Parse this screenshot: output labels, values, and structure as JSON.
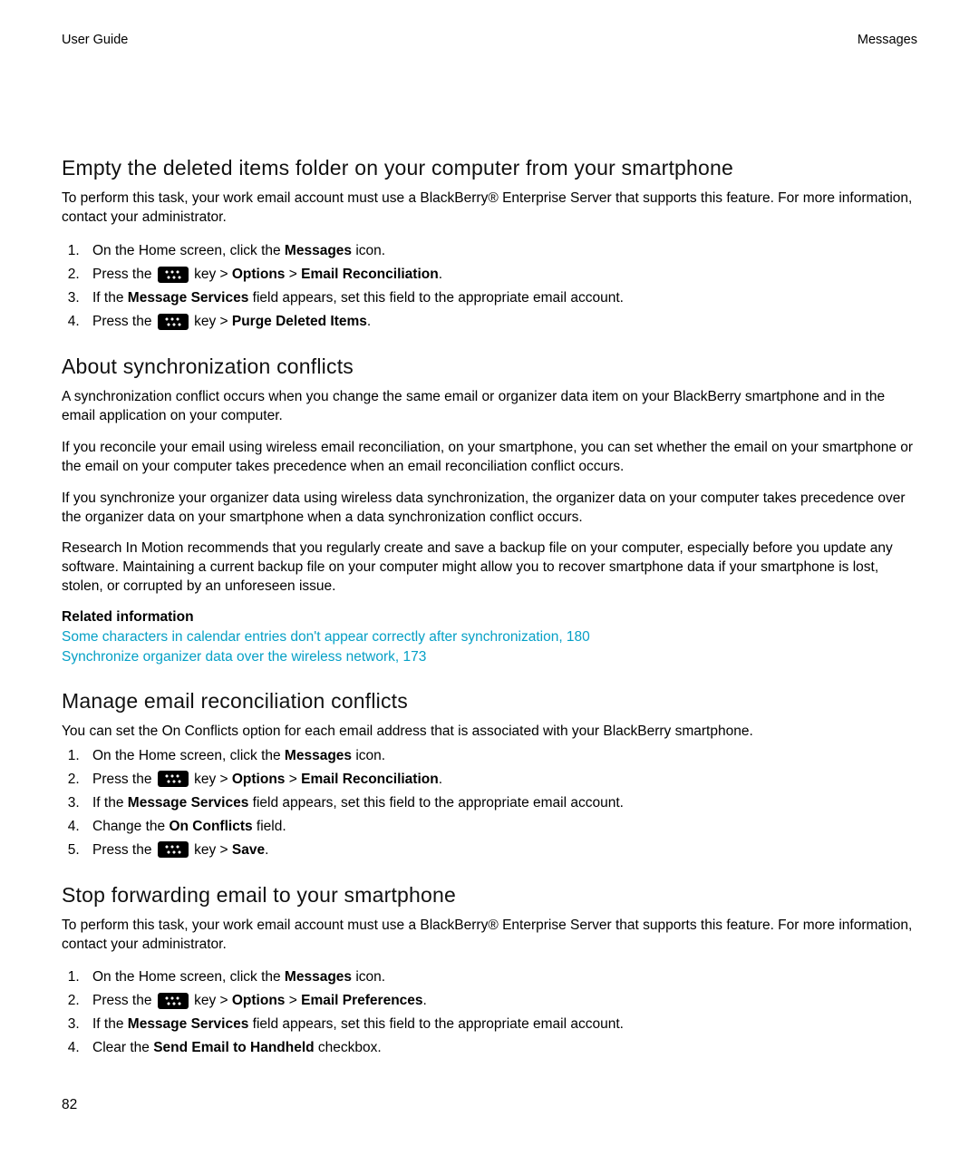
{
  "header": {
    "left": "User Guide",
    "right": "Messages"
  },
  "page_number": "82",
  "sec1": {
    "title": "Empty the deleted items folder on your computer from your smartphone",
    "intro": "To perform this task, your work email account must use a BlackBerry® Enterprise Server that supports this feature. For more information, contact your administrator.",
    "li1a": "On the Home screen, click the ",
    "li1b": "Messages",
    "li1c": " icon.",
    "li2a": "Press the ",
    "li2b": " key > ",
    "li2c": "Options",
    "li2d": " > ",
    "li2e": "Email Reconciliation",
    "li2f": ".",
    "li3a": "If the ",
    "li3b": "Message Services",
    "li3c": " field appears, set this field to the appropriate email account.",
    "li4a": "Press the ",
    "li4b": " key > ",
    "li4c": "Purge Deleted Items",
    "li4d": "."
  },
  "sec2": {
    "title": "About synchronization conflicts",
    "p1": "A synchronization conflict occurs when you change the same email or organizer data item on your BlackBerry smartphone and in the email application on your computer.",
    "p2": "If you reconcile your email using wireless email reconciliation, on your smartphone, you can set whether the email on your smartphone or the email on your computer takes precedence when an email reconciliation conflict occurs.",
    "p3": "If you synchronize your organizer data using wireless data synchronization, the organizer data on your computer takes precedence over the organizer data on your smartphone when a data synchronization conflict occurs.",
    "p4": "Research In Motion recommends that you regularly create and save a backup file on your computer, especially before you update any software. Maintaining a current backup file on your computer might allow you to recover smartphone data if your smartphone is lost, stolen, or corrupted by an unforeseen issue.",
    "related_heading": "Related information",
    "link1": "Some characters in calendar entries don't appear correctly after synchronization, 180",
    "link2": "Synchronize organizer data over the wireless network, 173"
  },
  "sec3": {
    "title": "Manage email reconciliation conflicts",
    "intro": "You can set the On Conflicts option for each email address that is associated with your BlackBerry smartphone.",
    "li1a": "On the Home screen, click the ",
    "li1b": "Messages",
    "li1c": " icon.",
    "li2a": "Press the ",
    "li2b": " key > ",
    "li2c": "Options",
    "li2d": " > ",
    "li2e": "Email Reconciliation",
    "li2f": ".",
    "li3a": "If the ",
    "li3b": "Message Services",
    "li3c": " field appears, set this field to the appropriate email account.",
    "li4a": "Change the ",
    "li4b": "On Conflicts",
    "li4c": " field.",
    "li5a": "Press the ",
    "li5b": " key > ",
    "li5c": "Save",
    "li5d": "."
  },
  "sec4": {
    "title": "Stop forwarding email to your smartphone",
    "intro": "To perform this task, your work email account must use a BlackBerry® Enterprise Server that supports this feature. For more information, contact your administrator.",
    "li1a": "On the Home screen, click the ",
    "li1b": "Messages",
    "li1c": " icon.",
    "li2a": "Press the ",
    "li2b": " key > ",
    "li2c": "Options",
    "li2d": " > ",
    "li2e": "Email Preferences",
    "li2f": ".",
    "li3a": "If the ",
    "li3b": "Message Services",
    "li3c": " field appears, set this field to the appropriate email account.",
    "li4a": "Clear the ",
    "li4b": "Send Email to Handheld",
    "li4c": " checkbox."
  }
}
